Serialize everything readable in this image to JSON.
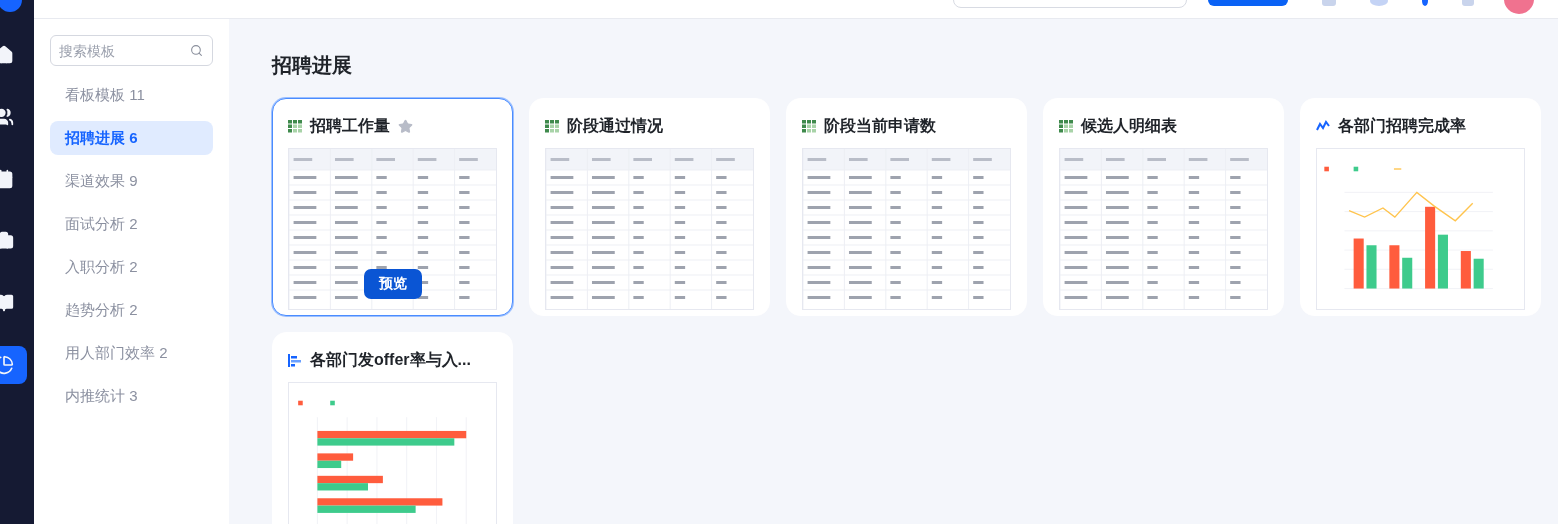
{
  "nav": {
    "items": [
      {
        "selected": false
      },
      {
        "selected": false
      },
      {
        "selected": false
      },
      {
        "selected": false
      },
      {
        "selected": false
      },
      {
        "selected": true
      }
    ]
  },
  "sidebar": {
    "search": {
      "placeholder": "搜索模板"
    },
    "items": [
      {
        "label": "看板模板 11",
        "selected": false
      },
      {
        "label": "招聘进展 6",
        "selected": true
      },
      {
        "label": "渠道效果 9",
        "selected": false
      },
      {
        "label": "面试分析 2",
        "selected": false
      },
      {
        "label": "入职分析 2",
        "selected": false
      },
      {
        "label": "趋势分析 2",
        "selected": false
      },
      {
        "label": "用人部门效率 2",
        "selected": false
      },
      {
        "label": "内推统计 3",
        "selected": false
      }
    ]
  },
  "section": {
    "title": "招聘进展"
  },
  "cards": [
    {
      "title": "招聘工作量",
      "kind": "table",
      "hovered": true,
      "action": "预览"
    },
    {
      "title": "阶段通过情况",
      "kind": "table",
      "hovered": false
    },
    {
      "title": "阶段当前申请数",
      "kind": "table",
      "hovered": false
    },
    {
      "title": "候选人明细表",
      "kind": "table",
      "hovered": false
    },
    {
      "title": "各部门招聘完成率",
      "kind": "column_chart",
      "hovered": false
    },
    {
      "title": "各部门发offer率与入...",
      "kind": "bar_chart",
      "hovered": false
    }
  ]
}
